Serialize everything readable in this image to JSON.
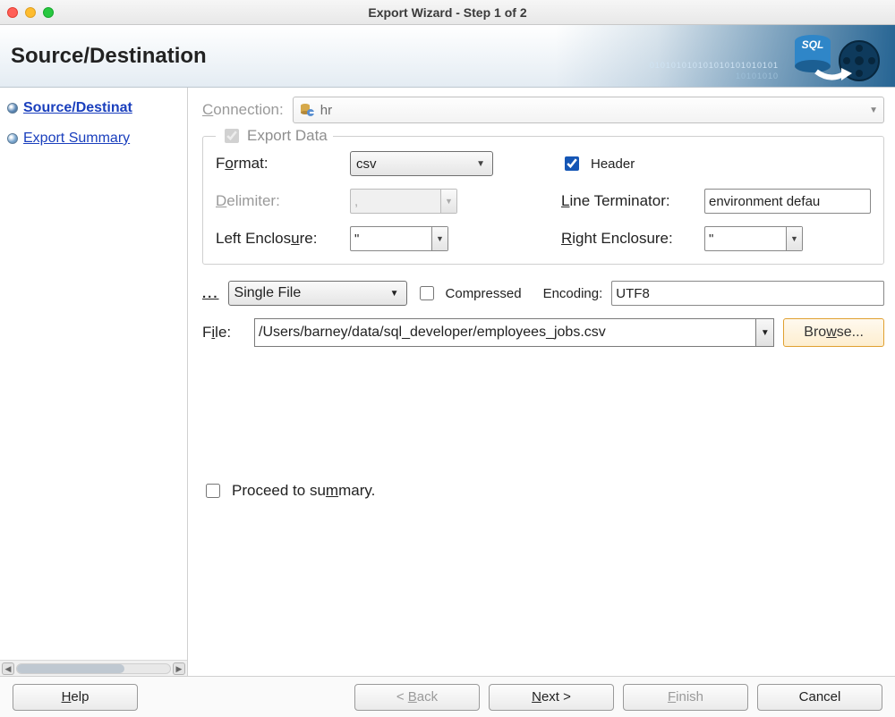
{
  "window": {
    "title": "Export Wizard - Step 1 of 2"
  },
  "heading": "Source/Destination",
  "sidebar": {
    "steps": [
      {
        "label": "Source/Destinat",
        "current": true
      },
      {
        "label": "Export Summary",
        "current": false
      }
    ]
  },
  "form": {
    "connection_label": "Connection:",
    "connection_value": "hr",
    "export_data_label": "Export Data",
    "export_data_checked": true,
    "format_label": "Format:",
    "format_value": "csv",
    "header_label": "Header",
    "header_checked": true,
    "delimiter_label": "Delimiter:",
    "delimiter_value": ",",
    "line_terminator_label": "Line Terminator:",
    "line_terminator_value": "environment defau",
    "left_enclosure_label": "Left Enclosure:",
    "left_enclosure_value": "\"",
    "right_enclosure_label": "Right Enclosure:",
    "right_enclosure_value": "\"",
    "saveas_dots": "...",
    "saveas_value": "Single File",
    "compressed_label": "Compressed",
    "compressed_checked": false,
    "encoding_label": "Encoding:",
    "encoding_value": "UTF8",
    "file_label": "File:",
    "file_value": "/Users/barney/data/sql_developer/employees_jobs.csv",
    "browse_label": "Browse...",
    "proceed_label": "Proceed to summary.",
    "proceed_checked": false
  },
  "footer": {
    "help": "Help",
    "back": "< Back",
    "next": "Next >",
    "finish": "Finish",
    "cancel": "Cancel"
  }
}
